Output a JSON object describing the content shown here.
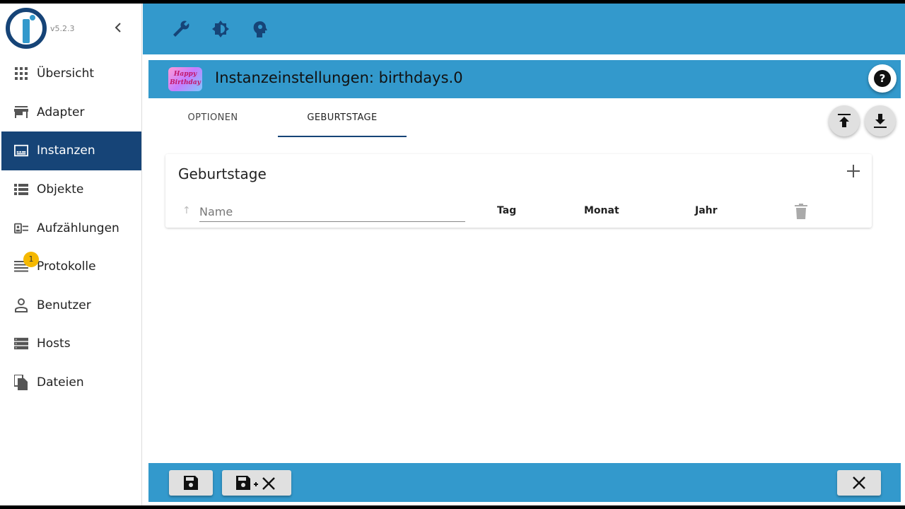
{
  "app": {
    "version": "v5.2.3"
  },
  "sidebar": {
    "items": [
      {
        "label": "Übersicht",
        "icon": "grid-icon",
        "active": false
      },
      {
        "label": "Adapter",
        "icon": "store-icon",
        "active": false
      },
      {
        "label": "Instanzen",
        "icon": "instances-icon",
        "active": true
      },
      {
        "label": "Objekte",
        "icon": "list-icon",
        "active": false
      },
      {
        "label": "Aufzählungen",
        "icon": "enum-icon",
        "active": false
      },
      {
        "label": "Protokolle",
        "icon": "log-icon",
        "active": false,
        "badge": "1"
      },
      {
        "label": "Benutzer",
        "icon": "user-icon",
        "active": false
      },
      {
        "label": "Hosts",
        "icon": "hosts-icon",
        "active": false
      },
      {
        "label": "Dateien",
        "icon": "files-icon",
        "active": false
      }
    ]
  },
  "topbar": {
    "icons": [
      "wrench-icon",
      "brightness-icon",
      "expert-mode-icon"
    ]
  },
  "dialog": {
    "title": "Instanzeinstellungen: birthdays.0",
    "logo_text": "Happy Birthday",
    "tabs": [
      {
        "label": "OPTIONEN",
        "active": false
      },
      {
        "label": "GEBURTSTAGE",
        "active": true
      }
    ],
    "card": {
      "title": "Geburtstage",
      "name_placeholder": "Name",
      "columns": [
        "Tag",
        "Monat",
        "Jahr"
      ]
    }
  },
  "colors": {
    "accent": "#3399cc",
    "dark": "#164477",
    "badge": "#f5b800"
  }
}
